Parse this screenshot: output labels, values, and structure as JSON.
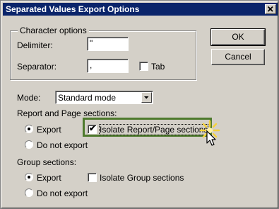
{
  "window": {
    "title": "Separated Values Export Options",
    "close_glyph": "✕"
  },
  "character_options": {
    "legend": "Character options",
    "delimiter_label": "Delimiter:",
    "delimiter_value": "\"",
    "separator_label": "Separator:",
    "separator_value": ",",
    "tab_label": "Tab",
    "tab_checked": false
  },
  "buttons": {
    "ok": "OK",
    "cancel": "Cancel"
  },
  "mode": {
    "label": "Mode:",
    "selected": "Standard mode"
  },
  "report_page_sections": {
    "label": "Report and Page sections:",
    "export_label": "Export",
    "do_not_export_label": "Do not export",
    "selected": "Export",
    "isolate_label": "Isolate Report/Page sections",
    "isolate_checked": true,
    "highlight_color": "#4e7a2d"
  },
  "group_sections": {
    "label": "Group sections:",
    "export_label": "Export",
    "do_not_export_label": "Do not export",
    "selected": "Export",
    "isolate_label": "Isolate Group sections",
    "isolate_checked": false
  },
  "icons": {
    "cursor": "arrow-cursor-icon",
    "click_burst": "click-sparkle-icon"
  },
  "colors": {
    "title_bar": "#0a246a",
    "dialog_bg": "#d4d0c8",
    "click_burst": "#f5d23a"
  }
}
